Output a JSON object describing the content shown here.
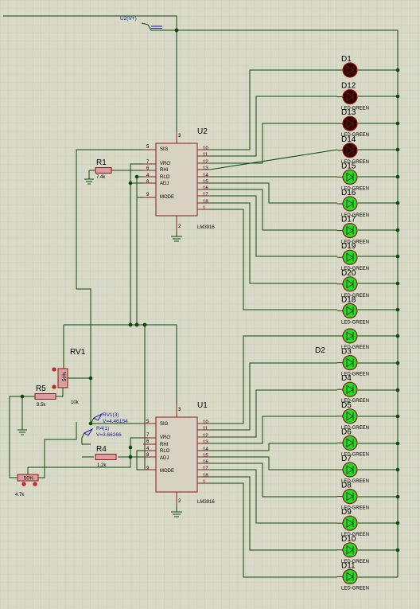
{
  "colors": {
    "background": "#d9d9c8",
    "grid": "#c4c4b0",
    "wire": "#0a4a0a",
    "component_outline": "#8a1a1a",
    "ic_fill": "#d8d2c2",
    "led_on_green": "#22dd22",
    "led_off_red": "#3a0000",
    "probe_blue": "#1a1aa0"
  },
  "power": {
    "label": "U2(V+)"
  },
  "chips": [
    {
      "ref": "U2",
      "part": "LM3916",
      "pins": {
        "sig": "SIG",
        "vro": "VRO",
        "rhi": "RHI",
        "rlo": "RLO",
        "adj": "ADJ",
        "mode": "MODE",
        "n5": "5",
        "n7": "7",
        "n6": "6",
        "n4": "4",
        "n8": "8",
        "n9": "9",
        "n3": "3",
        "n2": "2",
        "r10": "10",
        "r11": "11",
        "r12": "12",
        "r13": "13",
        "r14": "14",
        "r15": "15",
        "r16": "16",
        "r17": "17",
        "r18": "18",
        "r1": "1"
      }
    },
    {
      "ref": "U1",
      "part": "LM3916",
      "pins": {
        "sig": "SIG",
        "vro": "VRO",
        "rhi": "RHI",
        "rlo": "RLO",
        "adj": "ADJ",
        "mode": "MODE",
        "n5": "5",
        "n7": "7",
        "n6": "6",
        "n4": "4",
        "n8": "8",
        "n9": "9",
        "n3": "3",
        "n2": "2",
        "r10": "10",
        "r11": "11",
        "r12": "12",
        "r13": "13",
        "r14": "14",
        "r15": "15",
        "r16": "16",
        "r17": "17",
        "r18": "18",
        "r1": "1"
      }
    }
  ],
  "resistors": [
    {
      "ref": "R1",
      "value": "7.4k"
    },
    {
      "ref": "R4",
      "value": "1.2k"
    },
    {
      "ref": "R5",
      "value": "9.5k"
    }
  ],
  "pots": [
    {
      "ref": "RV1",
      "value": "10k",
      "body_text": "50%"
    },
    {
      "ref": "",
      "value": "4.7k",
      "body_text": "50%"
    }
  ],
  "probes": [
    {
      "label": "RV1(3)",
      "reading": "V=4.46154"
    },
    {
      "label": "R4(1)",
      "reading": "V=3.66266"
    }
  ],
  "led_bank_top": [
    {
      "ref": "D1",
      "type": "",
      "lit": false
    },
    {
      "ref": "D12",
      "type": "LED-GREEN",
      "lit": false
    },
    {
      "ref": "D13",
      "type": "LED-GREEN",
      "lit": false
    },
    {
      "ref": "D14",
      "type": "LED-GREEN",
      "lit": false
    },
    {
      "ref": "D15",
      "type": "LED-GREEN",
      "lit": true
    },
    {
      "ref": "D16",
      "type": "LED-GREEN",
      "lit": true
    },
    {
      "ref": "D17",
      "type": "LED-GREEN",
      "lit": true
    },
    {
      "ref": "D19",
      "type": "LED-GREEN",
      "lit": true
    },
    {
      "ref": "D20",
      "type": "LED-GREEN",
      "lit": true
    },
    {
      "ref": "D18",
      "type": "LED-GREEN",
      "lit": true
    }
  ],
  "led_bank_bottom_label": "D2",
  "led_bank_bottom": [
    {
      "ref": "",
      "type": "LED-GREEN",
      "lit": true
    },
    {
      "ref": "D3",
      "type": "LED-GREEN",
      "lit": true
    },
    {
      "ref": "D4",
      "type": "LED-GREEN",
      "lit": true
    },
    {
      "ref": "D5",
      "type": "LED-GREEN",
      "lit": true
    },
    {
      "ref": "D6",
      "type": "LED-GREEN",
      "lit": true
    },
    {
      "ref": "D7",
      "type": "LED-GREEN",
      "lit": true
    },
    {
      "ref": "D8",
      "type": "LED-GREEN",
      "lit": true
    },
    {
      "ref": "D9",
      "type": "LED-GREEN",
      "lit": true
    },
    {
      "ref": "D10",
      "type": "LED-GREEN",
      "lit": true
    },
    {
      "ref": "D11",
      "type": "LED-GREEN",
      "lit": true
    }
  ]
}
